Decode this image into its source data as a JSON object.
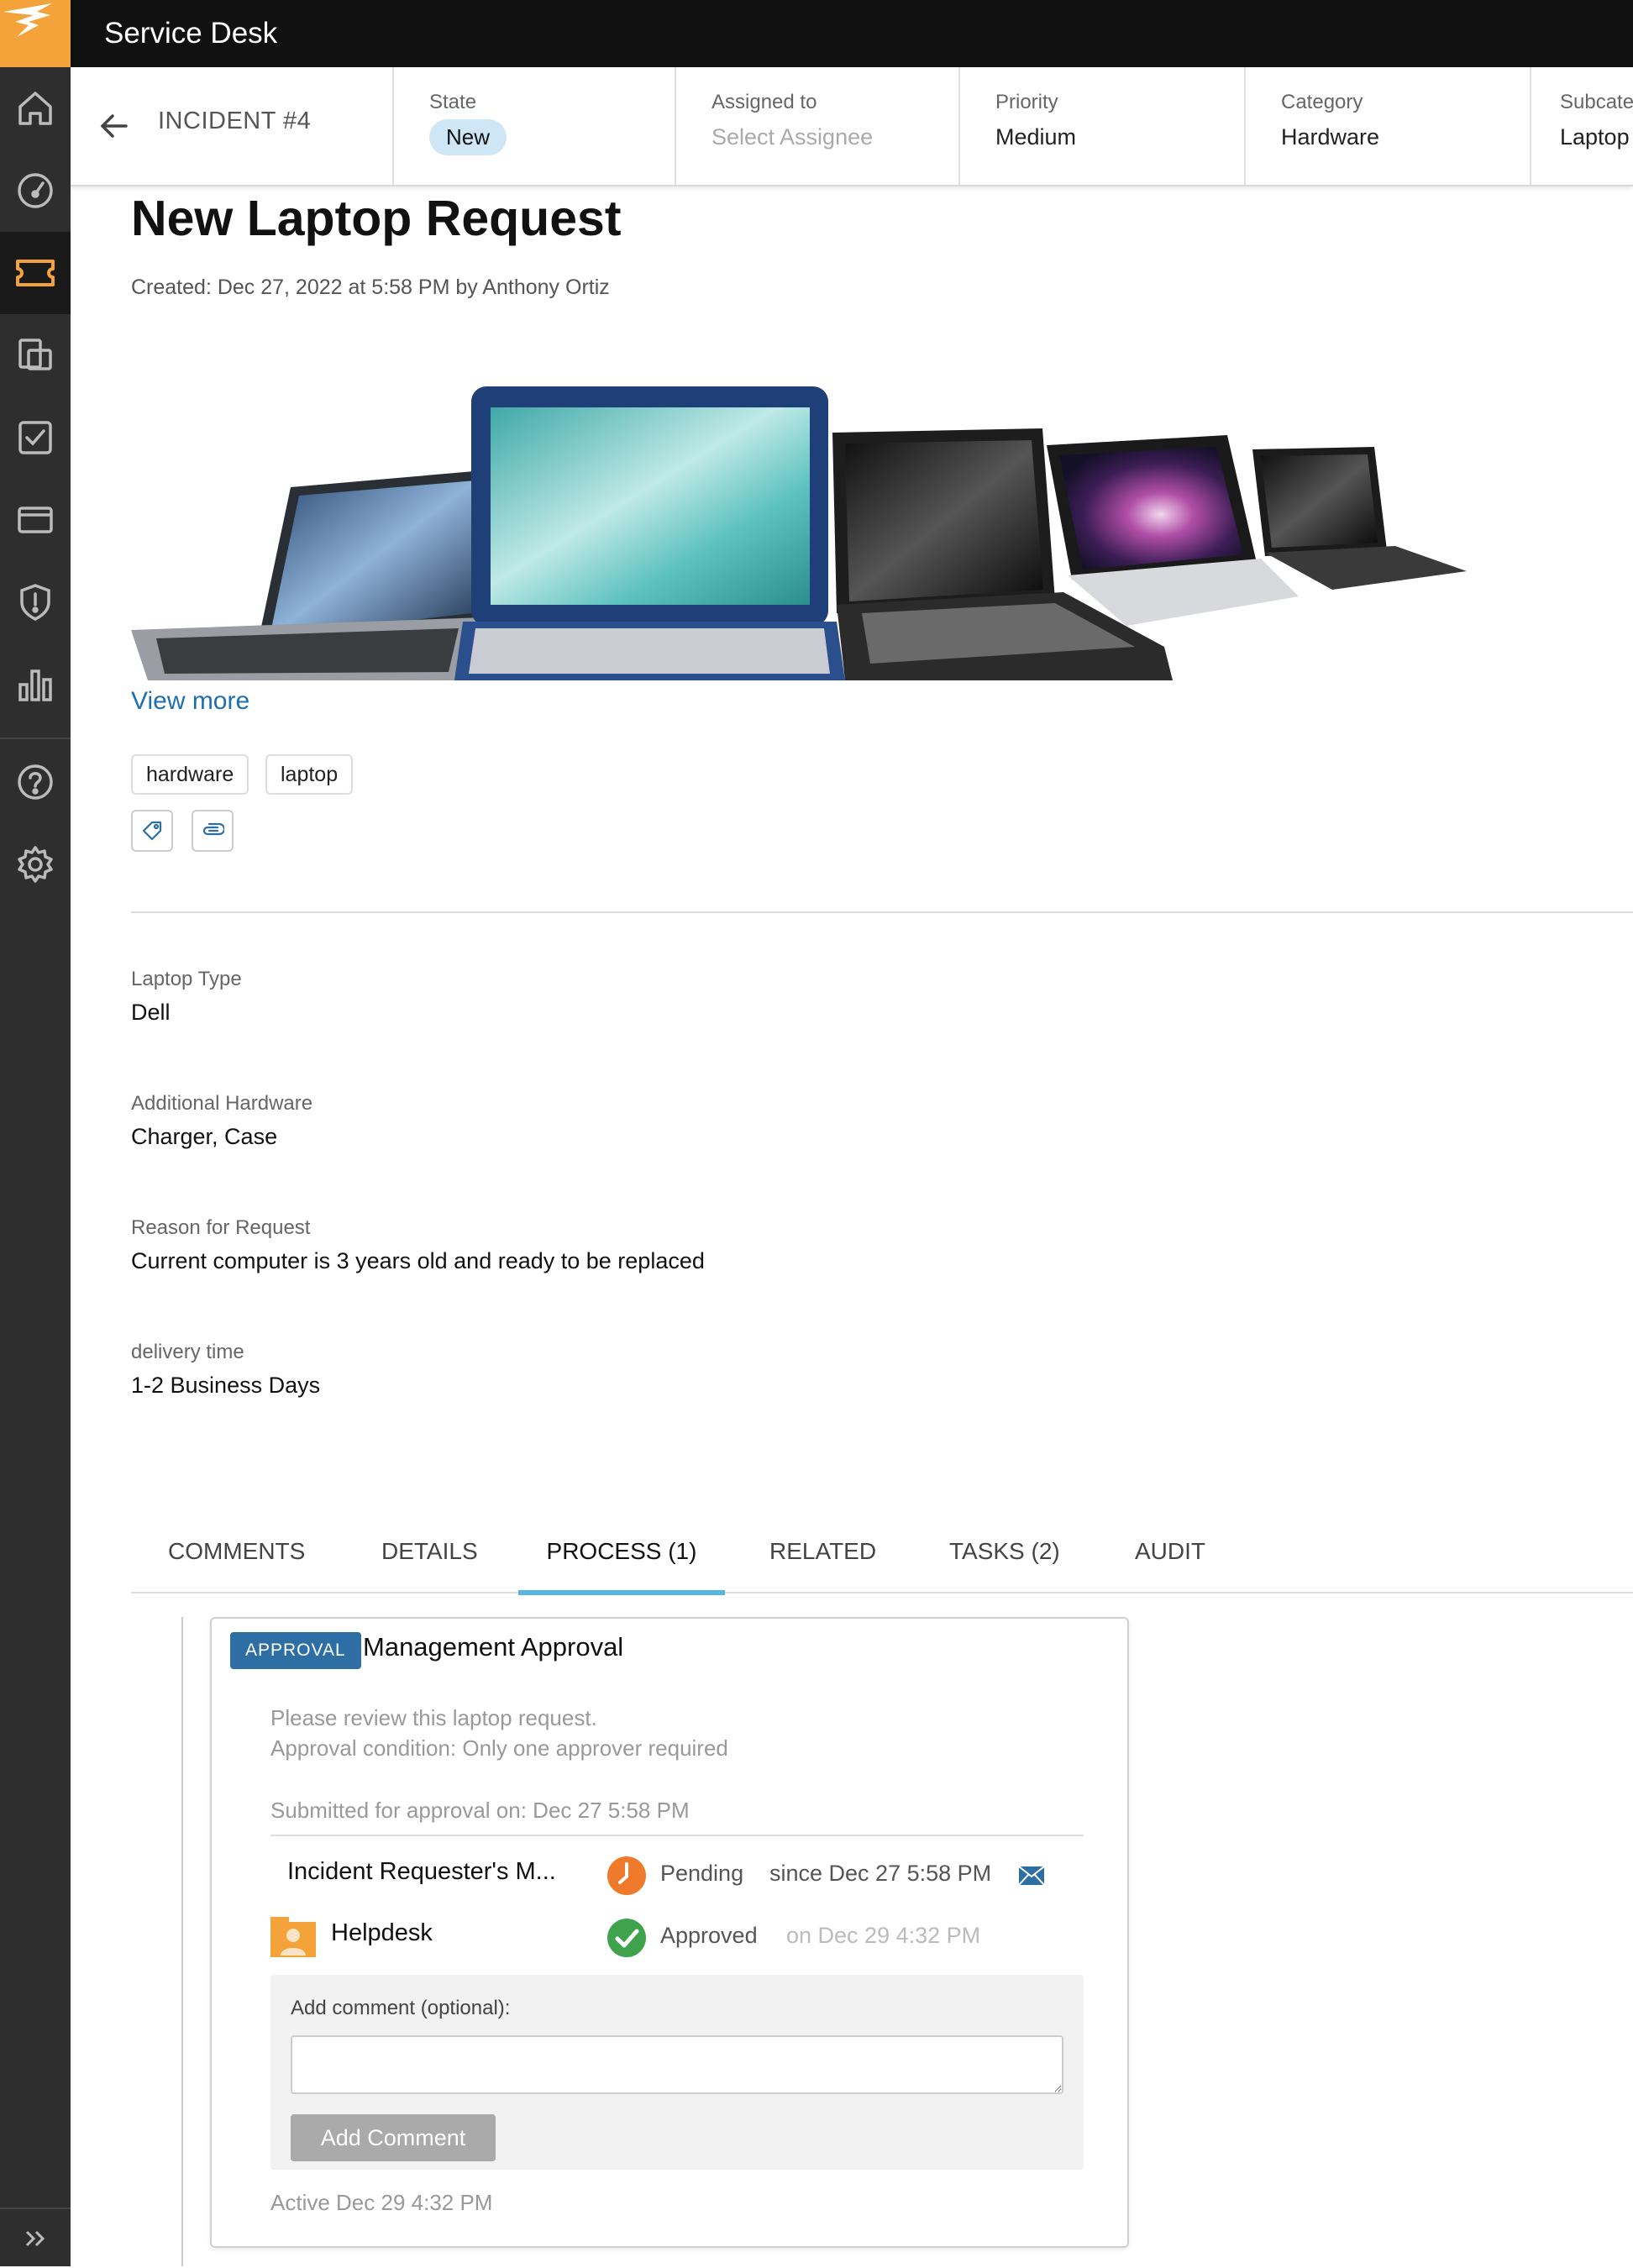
{
  "app": {
    "title": "Service Desk"
  },
  "sidebar": {
    "items": [
      {
        "icon": "home-icon"
      },
      {
        "icon": "dashboard-icon"
      },
      {
        "icon": "ticket-icon",
        "active": true
      },
      {
        "icon": "assets-icon"
      },
      {
        "icon": "tasks-icon"
      },
      {
        "icon": "card-icon"
      },
      {
        "icon": "shield-icon"
      },
      {
        "icon": "reports-icon"
      },
      {
        "icon": "help-icon"
      },
      {
        "icon": "gear-icon"
      }
    ],
    "expand_icon": "double-chevron-right-icon"
  },
  "header": {
    "incident_id": "INCIDENT #4",
    "state": {
      "label": "State",
      "value": "New"
    },
    "assigned_to": {
      "label": "Assigned to",
      "value": "Select Assignee"
    },
    "priority": {
      "label": "Priority",
      "value": "Medium"
    },
    "category": {
      "label": "Category",
      "value": "Hardware"
    },
    "subcategory": {
      "label": "Subcate",
      "value": "Laptop"
    }
  },
  "ticket": {
    "title": "New Laptop Request",
    "created": "Created: Dec 27, 2022 at 5:58 PM by Anthony Ortiz",
    "view_more": "View more",
    "tags": [
      "hardware",
      "laptop"
    ],
    "fields": [
      {
        "label": "Laptop Type",
        "value": "Dell"
      },
      {
        "label": "Additional Hardware",
        "value": "Charger, Case"
      },
      {
        "label": "Reason for Request",
        "value": "Current computer is 3 years old and ready to be replaced"
      },
      {
        "label": "delivery time",
        "value": "1-2 Business Days"
      }
    ]
  },
  "tabs": [
    {
      "label": "COMMENTS"
    },
    {
      "label": "DETAILS"
    },
    {
      "label": "PROCESS (1)",
      "active": true
    },
    {
      "label": "RELATED"
    },
    {
      "label": "TASKS (2)"
    },
    {
      "label": "AUDIT"
    }
  ],
  "approval": {
    "badge": "APPROVAL",
    "title": "Management Approval",
    "description": "Please review this laptop request.",
    "condition": "Approval condition: Only one approver required",
    "submitted": "Submitted for approval on: Dec 27 5:58 PM",
    "approvers": [
      {
        "name": "Incident Requester's M...",
        "status": "Pending",
        "time": "since Dec 27 5:58 PM",
        "status_icon": "clock-icon",
        "action_icon": "mail-icon"
      },
      {
        "name": "Helpdesk",
        "status": "Approved",
        "time": "on Dec 29 4:32 PM",
        "status_icon": "check-icon",
        "avatar_icon": "group-avatar-icon"
      }
    ],
    "comment_label": "Add comment (optional):",
    "comment_value": "",
    "add_comment_button": "Add Comment",
    "active": "Active Dec 29 4:32 PM"
  },
  "colors": {
    "brand": "#f3a33a",
    "topbar": "#111111",
    "sidebar": "#2e2e2e",
    "link": "#1d6fb0",
    "tab_active": "#57b6dd",
    "badge": "#2d6ea4",
    "pending": "#f07a2b",
    "approved": "#3fa34d"
  }
}
